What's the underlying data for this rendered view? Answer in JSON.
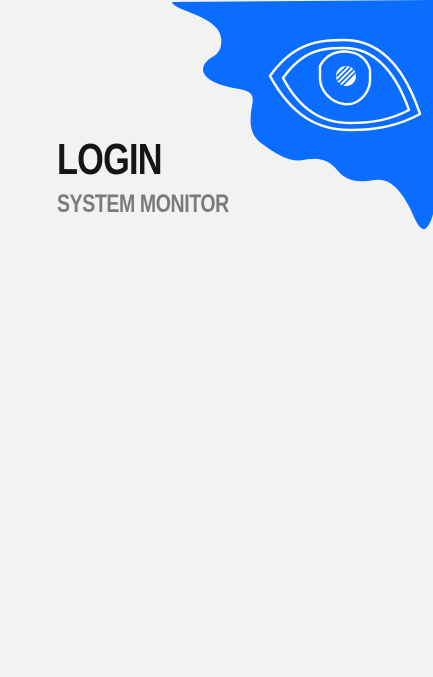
{
  "header": {
    "title": "LOGIN",
    "subtitle": "SYSTEM MONITOR"
  },
  "brand": {
    "icon": "eye-icon",
    "accent_color": "#0a6dff",
    "background_color": "#f2f2f2",
    "title_color": "#151515",
    "subtitle_color": "#7b7b7b"
  }
}
